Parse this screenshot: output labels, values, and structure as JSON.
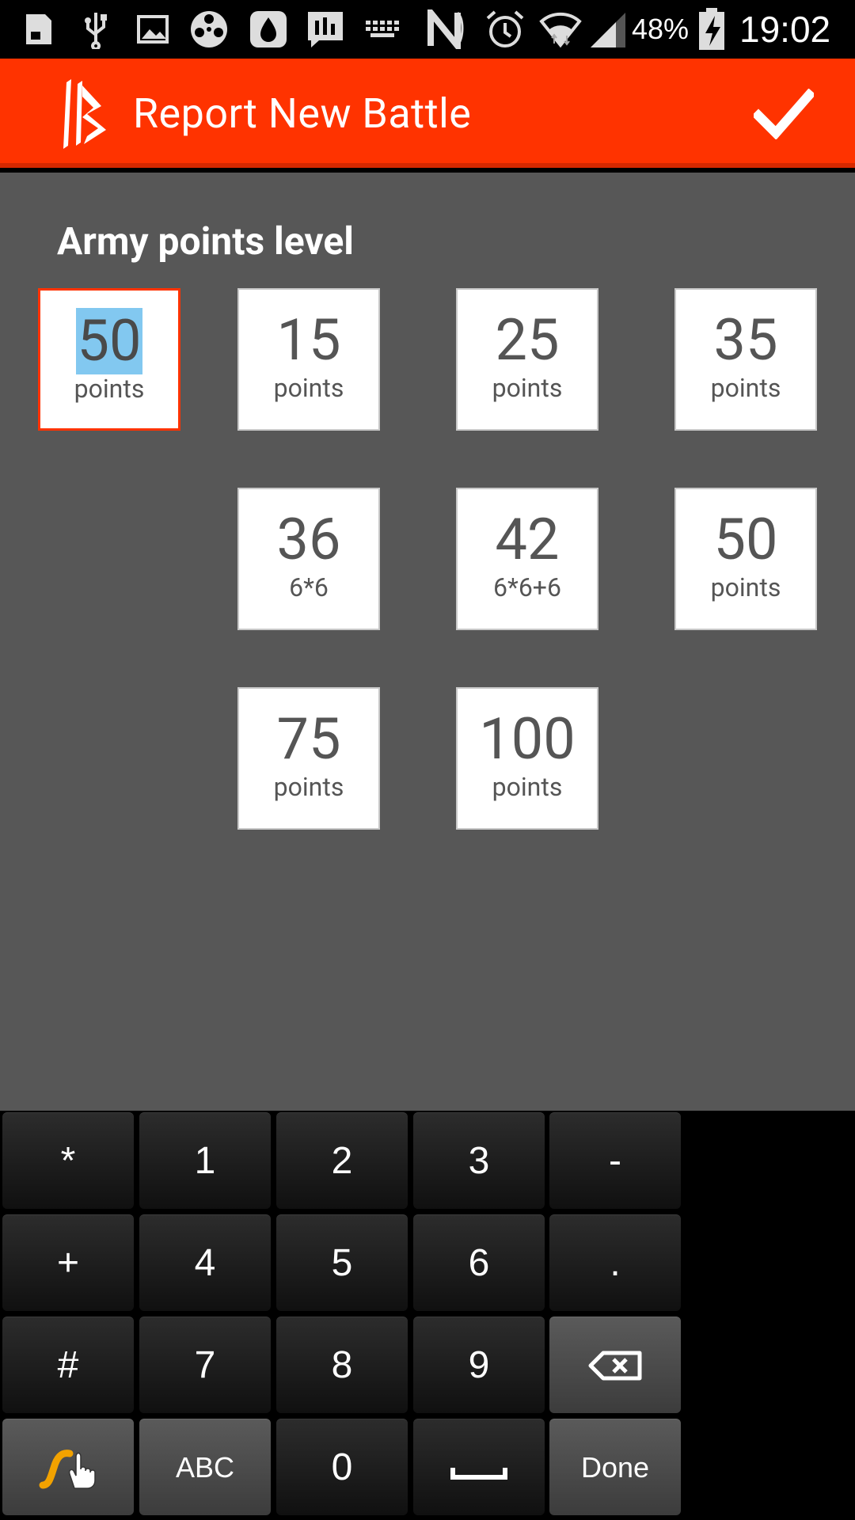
{
  "status_bar": {
    "battery_percent": "48%",
    "time": "19:02"
  },
  "action_bar": {
    "title": "Report New Battle"
  },
  "main": {
    "section_title": "Army points level",
    "tiles": [
      {
        "value": "50",
        "subtitle": "points"
      },
      {
        "value": "15",
        "subtitle": "points"
      },
      {
        "value": "25",
        "subtitle": "points"
      },
      {
        "value": "35",
        "subtitle": "points"
      },
      {
        "value": "36",
        "subtitle": "6*6"
      },
      {
        "value": "42",
        "subtitle": "6*6+6"
      },
      {
        "value": "50",
        "subtitle": "points"
      },
      {
        "value": "75",
        "subtitle": "points"
      },
      {
        "value": "100",
        "subtitle": "points"
      }
    ]
  },
  "keyboard": {
    "keys": [
      "*",
      "1",
      "2",
      "3",
      "-",
      "+",
      "4",
      "5",
      "6",
      ".",
      "#",
      "7",
      "8",
      "9",
      "ABC",
      "0",
      "Done"
    ]
  },
  "colors": {
    "accent": "#ff3300",
    "content_bg": "#575757",
    "selection": "#82c8f0"
  }
}
